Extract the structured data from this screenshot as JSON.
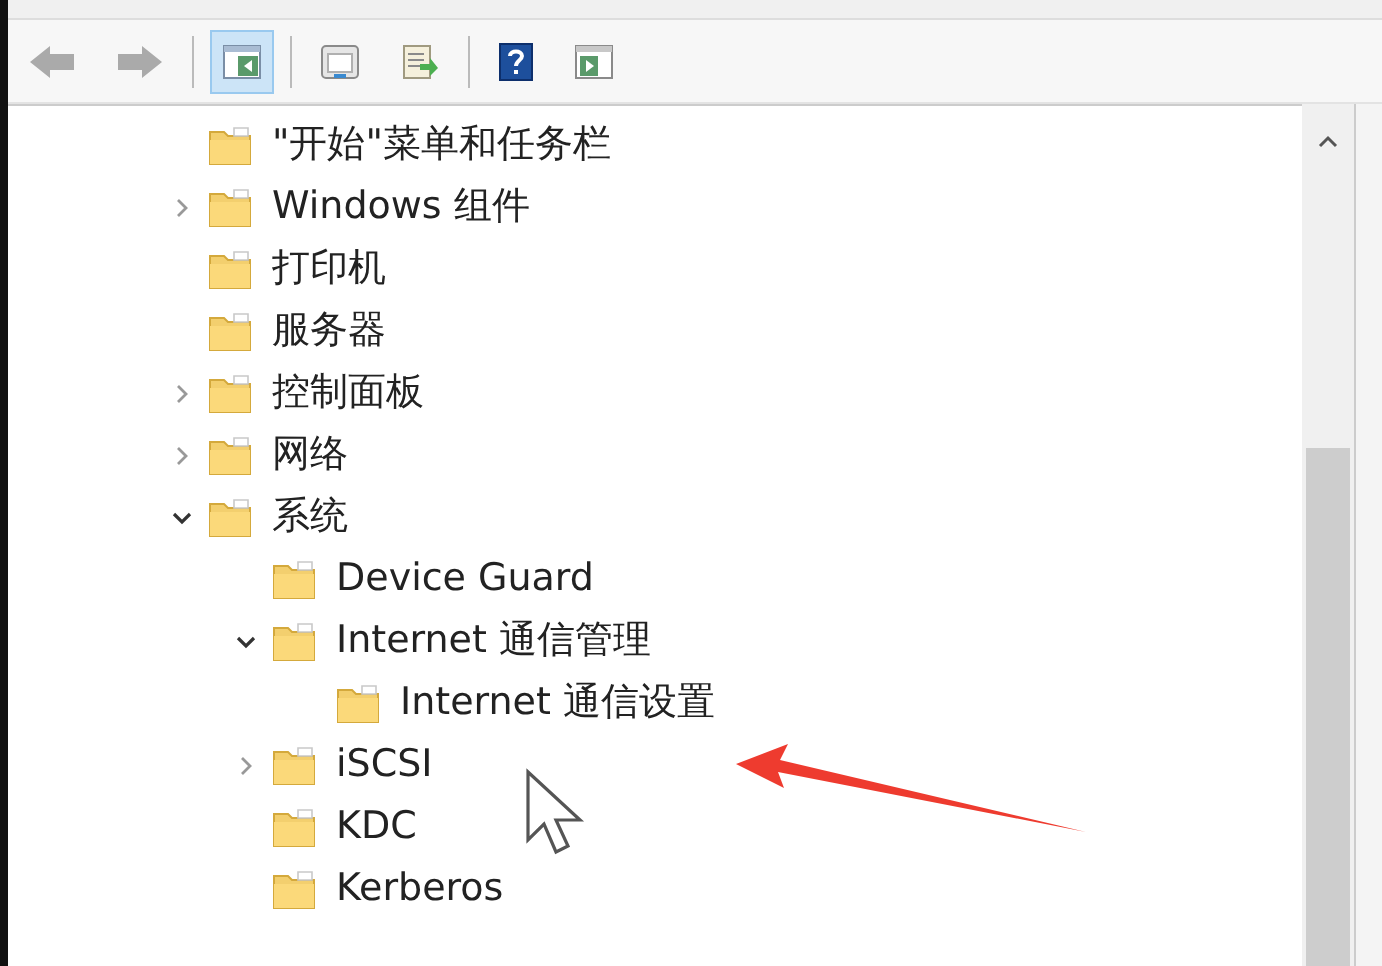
{
  "toolbar": {
    "buttons": [
      {
        "kind": "back",
        "disabled": true
      },
      {
        "kind": "forward",
        "disabled": true
      },
      {
        "kind": "tree-toggle",
        "selected": true
      },
      {
        "kind": "properties",
        "selected": false
      },
      {
        "kind": "export",
        "selected": false
      },
      {
        "kind": "help",
        "selected": false
      },
      {
        "kind": "action-pane",
        "selected": false
      }
    ]
  },
  "tree": {
    "items": [
      {
        "label": "\"开始\"菜单和任务栏"
      },
      {
        "label": "Windows 组件",
        "expanded": false
      },
      {
        "label": "打印机"
      },
      {
        "label": "服务器"
      },
      {
        "label": "控制面板",
        "expanded": false
      },
      {
        "label": "网络",
        "expanded": false
      },
      {
        "label": "系统",
        "expanded": true,
        "children": [
          {
            "label": "Device Guard"
          },
          {
            "label": "Internet 通信管理",
            "expanded": true,
            "children": [
              {
                "label": "Internet 通信设置"
              }
            ]
          },
          {
            "label": "iSCSI",
            "expanded": false
          },
          {
            "label": "KDC"
          },
          {
            "label": "Kerberos"
          }
        ]
      }
    ]
  }
}
